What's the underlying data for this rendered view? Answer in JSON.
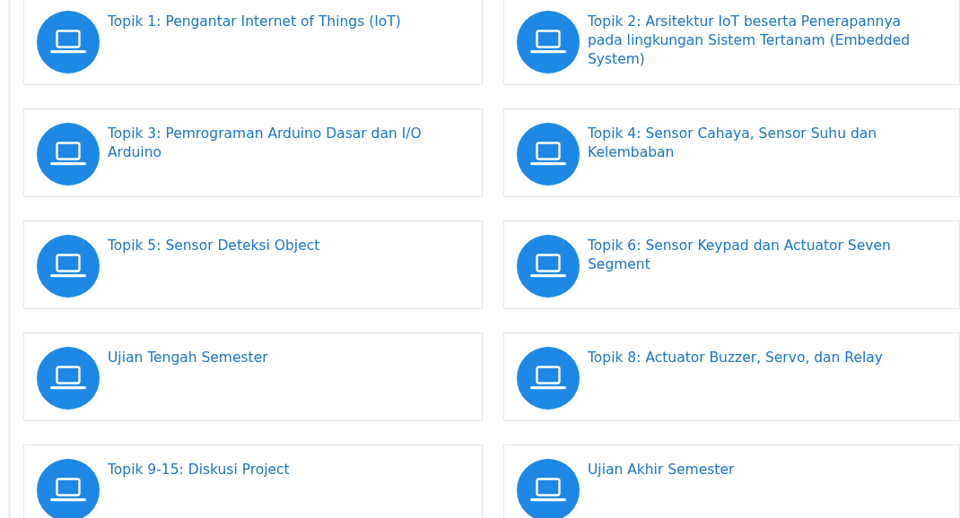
{
  "topics": [
    {
      "title": "Topik 1: Pengantar Internet of Things (IoT)"
    },
    {
      "title": "Topik 2: Arsitektur IoT beserta Penerapannya pada lingkungan Sistem Tertanam (Embedded System)"
    },
    {
      "title": "Topik 3: Pemrograman Arduino Dasar dan I/O Arduino"
    },
    {
      "title": "Topik 4: Sensor Cahaya, Sensor Suhu dan Kelembaban"
    },
    {
      "title": "Topik 5: Sensor Deteksi Object"
    },
    {
      "title": "Topik 6: Sensor Keypad dan Actuator Seven Segment"
    },
    {
      "title": "Ujian Tengah Semester"
    },
    {
      "title": "Topik 8: Actuator Buzzer, Servo, dan Relay"
    },
    {
      "title": "Topik 9-15: Diskusi Project"
    },
    {
      "title": "Ujian Akhir Semester"
    }
  ]
}
